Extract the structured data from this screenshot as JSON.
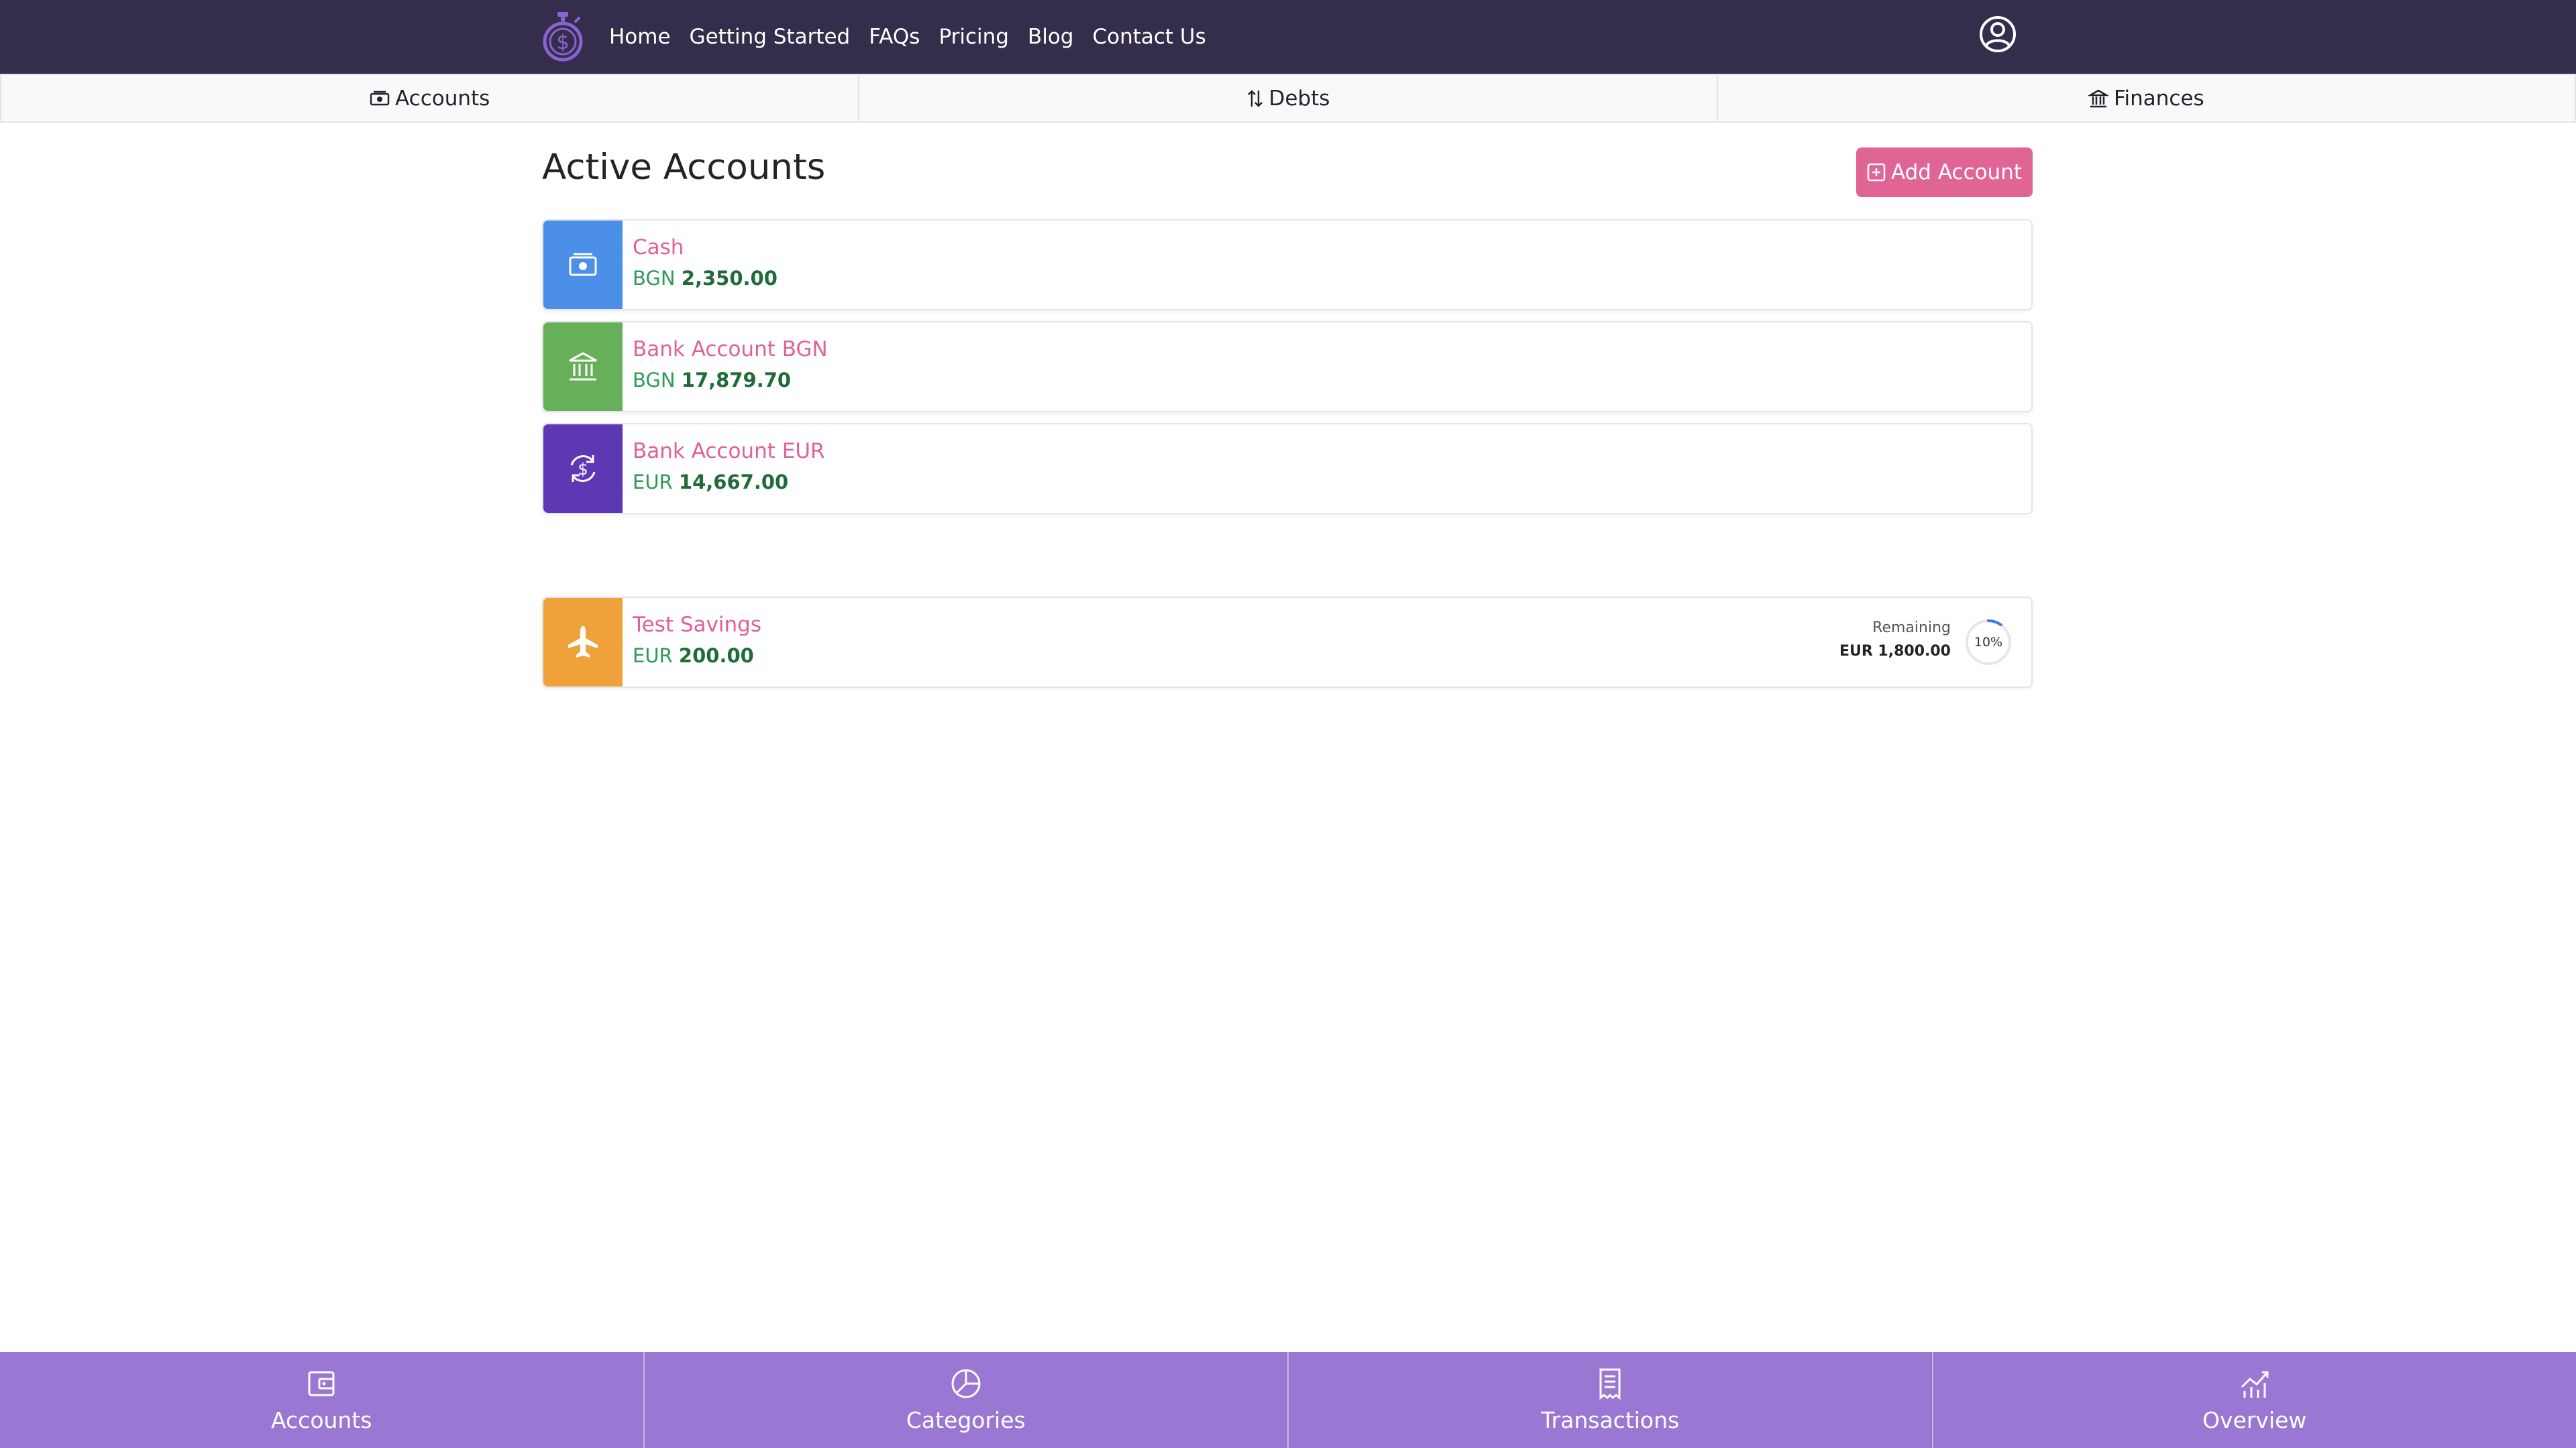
{
  "colors": {
    "navbar": "#342d4c",
    "accent_pink": "#e06595",
    "bottom_nav": "#9b77d4",
    "balance_green": "#2e9a58"
  },
  "header": {
    "nav": [
      {
        "label": "Home"
      },
      {
        "label": "Getting Started"
      },
      {
        "label": "FAQs"
      },
      {
        "label": "Pricing"
      },
      {
        "label": "Blog"
      },
      {
        "label": "Contact Us"
      }
    ],
    "logo_icon": "stopwatch-dollar-icon",
    "user_icon": "user-circle-icon"
  },
  "subnav": {
    "tabs": [
      {
        "label": "Accounts",
        "icon": "cash-icon"
      },
      {
        "label": "Debts",
        "icon": "arrows-up-down-icon"
      },
      {
        "label": "Finances",
        "icon": "bank-icon"
      }
    ]
  },
  "main": {
    "title": "Active Accounts",
    "add_button": "Add Account",
    "accounts": [
      {
        "name": "Cash",
        "currency": "BGN",
        "amount": "2,350.00",
        "icon": "cash-icon",
        "color": "#4b8fe8"
      },
      {
        "name": "Bank Account BGN",
        "currency": "BGN",
        "amount": "17,879.70",
        "icon": "bank-icon",
        "color": "#67b05a"
      },
      {
        "name": "Bank Account EUR",
        "currency": "EUR",
        "amount": "14,667.00",
        "icon": "currency-exchange-icon",
        "color": "#5e37b5"
      }
    ],
    "savings": [
      {
        "name": "Test Savings",
        "currency": "EUR",
        "amount": "200.00",
        "icon": "airplane-icon",
        "color": "#f0a23a",
        "remaining_label": "Remaining",
        "remaining_value": "EUR 1,800.00",
        "progress_text": "10%",
        "progress": 0.1
      }
    ]
  },
  "bottom_nav": {
    "tabs": [
      {
        "label": "Accounts",
        "icon": "wallet-icon"
      },
      {
        "label": "Categories",
        "icon": "pie-chart-icon"
      },
      {
        "label": "Transactions",
        "icon": "receipt-icon"
      },
      {
        "label": "Overview",
        "icon": "graph-up-icon"
      }
    ]
  }
}
